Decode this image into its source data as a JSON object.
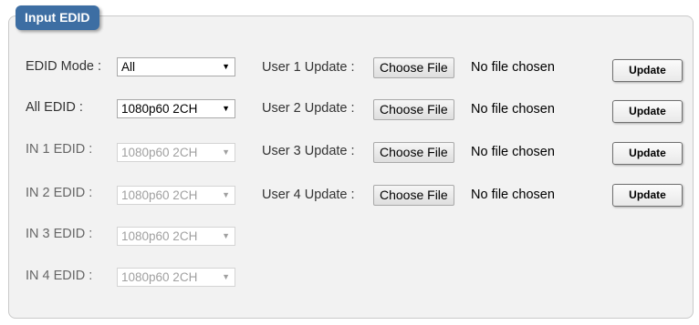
{
  "panel": {
    "title": "Input EDID"
  },
  "edid_mode": {
    "label": "EDID Mode :",
    "value": "All"
  },
  "edid_rows": [
    {
      "label": "All EDID :",
      "value": "1080p60 2CH",
      "enabled": true
    },
    {
      "label": "IN 1 EDID :",
      "value": "1080p60 2CH",
      "enabled": false
    },
    {
      "label": "IN 2 EDID :",
      "value": "1080p60 2CH",
      "enabled": false
    },
    {
      "label": "IN 3 EDID :",
      "value": "1080p60 2CH",
      "enabled": false
    },
    {
      "label": "IN 4 EDID :",
      "value": "1080p60 2CH",
      "enabled": false
    }
  ],
  "user_updates": [
    {
      "label": "User 1 Update :",
      "choose_label": "Choose File",
      "file_status": "No file chosen",
      "update_label": "Update"
    },
    {
      "label": "User 2 Update :",
      "choose_label": "Choose File",
      "file_status": "No file chosen",
      "update_label": "Update"
    },
    {
      "label": "User 3 Update :",
      "choose_label": "Choose File",
      "file_status": "No file chosen",
      "update_label": "Update"
    },
    {
      "label": "User 4 Update :",
      "choose_label": "Choose File",
      "file_status": "No file chosen",
      "update_label": "Update"
    }
  ],
  "icons": {
    "dropdown": "triangle-down-icon"
  },
  "colors": {
    "tab_bg": "#3d6ea3",
    "panel_bg": "#f2f2f2"
  }
}
